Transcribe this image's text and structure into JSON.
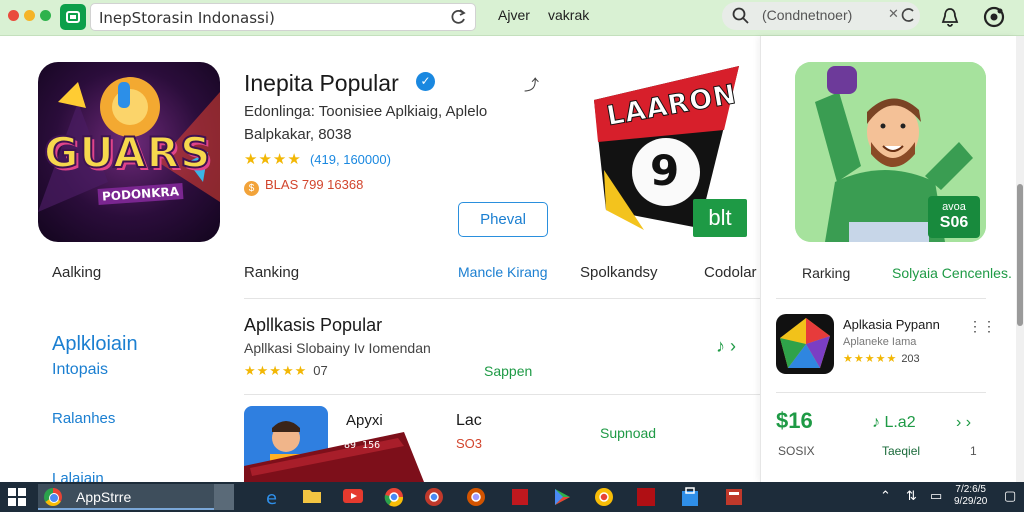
{
  "window": {
    "traffic_colors": [
      "#e94b3c",
      "#f5b428",
      "#2fb24c"
    ],
    "url": "InepStorasin Indonassi)",
    "nav_links": [
      "Ajver",
      "vakrak"
    ],
    "search_text": "(Condnetnoer)"
  },
  "hero": {
    "art_text": "GUARS",
    "art_subtext": "PODONKRA",
    "title": "Inepita Popular",
    "subtitle1": "Edonlinga: Toonisiee Aplkiaig, Aplelo",
    "subtitle2": "Balpkakar, 8038",
    "stars": "★★★★",
    "rating_text": "(419, 160000)",
    "price_text": "BLAS 799 16368",
    "install_label": "Pheval"
  },
  "banner": {
    "headline": "LAARON",
    "digit": "9",
    "badge": "blt"
  },
  "nav": {
    "left_label": "Aalking",
    "items": [
      "Ranking",
      "Mancle Kirang",
      "Spolkandsy",
      "Codolar"
    ]
  },
  "sidebar": {
    "big_line1": "Aplkloiain",
    "big_line2": "Intopais",
    "small": "Ralanhes",
    "cut": "Lalaiain"
  },
  "popular": {
    "title": "Apllkasis Popular",
    "subtitle": "Apllkasi Slobainy Iv Iomendan",
    "stars": "★★★★★",
    "count": "07",
    "action": "Sappen",
    "item": {
      "name": "Apyxi",
      "col2_title": "Lac",
      "col2_price": "SO3",
      "action": "Supnoad",
      "art_caption": "89 156"
    }
  },
  "right_panel": {
    "badge_top": "avoa",
    "badge_value": "S06",
    "nav1": "Rarking",
    "nav2": "Solyaia Cencenles.",
    "app_name": "Aplkasia Pypann",
    "app_sub": "Aplaneke Iama",
    "app_stars": "★★★★★",
    "app_count": "203",
    "price": "$16",
    "price_sub": "SOSIX",
    "music_label": "L.a2",
    "music_sub": "Taeqiel",
    "count": "1"
  },
  "taskbar": {
    "app_label": "AppStrre",
    "clock_line1": "7/2:6/5",
    "clock_line2": "9/29/20"
  }
}
